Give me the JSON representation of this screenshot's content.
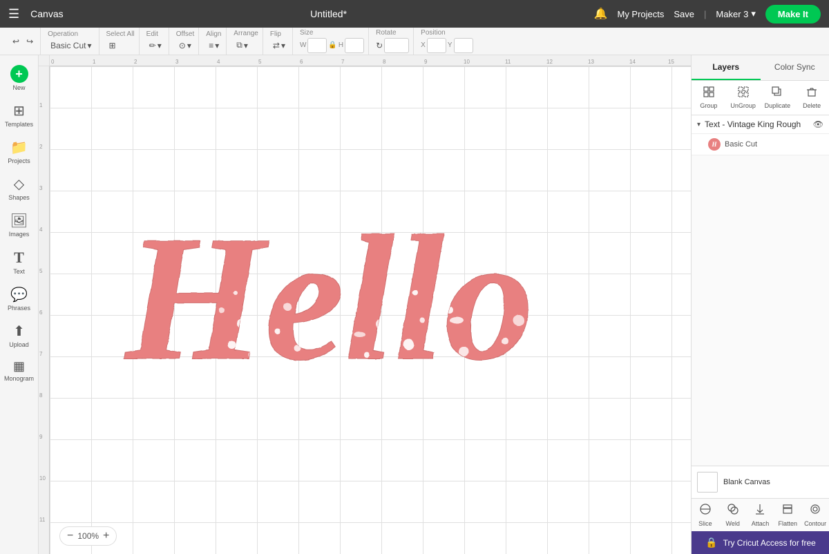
{
  "topbar": {
    "menu_icon": "☰",
    "title": "Canvas",
    "project_name": "Untitled*",
    "bell_icon": "🔔",
    "my_projects": "My Projects",
    "save": "Save",
    "divider": "|",
    "maker": "Maker 3",
    "maker_chevron": "▾",
    "make_it": "Make It"
  },
  "toolbar": {
    "undo_icon": "↩",
    "redo_icon": "↪",
    "operation_label": "Operation",
    "operation_value": "Basic Cut",
    "select_all_label": "Select All",
    "edit_label": "Edit",
    "offset_label": "Offset",
    "align_label": "Align",
    "arrange_label": "Arrange",
    "flip_label": "Flip",
    "size_label": "Size",
    "size_w": "W",
    "size_h": "H",
    "lock_icon": "🔒",
    "rotate_label": "Rotate",
    "position_label": "Position",
    "position_x": "X",
    "position_y": "Y"
  },
  "sidebar": {
    "items": [
      {
        "id": "new",
        "icon": "+",
        "label": "New"
      },
      {
        "id": "templates",
        "icon": "⊞",
        "label": "Templates"
      },
      {
        "id": "projects",
        "icon": "📁",
        "label": "Projects"
      },
      {
        "id": "shapes",
        "icon": "◇",
        "label": "Shapes"
      },
      {
        "id": "images",
        "icon": "🖼",
        "label": "Images"
      },
      {
        "id": "text",
        "icon": "T",
        "label": "Text"
      },
      {
        "id": "phrases",
        "icon": "💬",
        "label": "Phrases"
      },
      {
        "id": "upload",
        "icon": "⬆",
        "label": "Upload"
      },
      {
        "id": "monogram",
        "icon": "▦",
        "label": "Monogram"
      }
    ]
  },
  "right_panel": {
    "tabs": [
      {
        "id": "layers",
        "label": "Layers",
        "active": true
      },
      {
        "id": "color_sync",
        "label": "Color Sync",
        "active": false
      }
    ],
    "actions": [
      {
        "id": "group",
        "label": "Group",
        "icon": "⊞",
        "disabled": false
      },
      {
        "id": "ungroup",
        "label": "UnGroup",
        "icon": "⊟",
        "disabled": false
      },
      {
        "id": "duplicate",
        "label": "Duplicate",
        "icon": "⧉",
        "disabled": false
      },
      {
        "id": "delete",
        "label": "Delete",
        "icon": "🗑",
        "disabled": false
      }
    ],
    "layers": [
      {
        "id": "text-vintage",
        "name": "Text - Vintage King Rough",
        "expanded": true,
        "visible": true,
        "children": [
          {
            "id": "basic-cut",
            "name": "Basic Cut",
            "color": "#e88080"
          }
        ]
      }
    ],
    "blank_canvas": {
      "label": "Blank Canvas"
    },
    "bottom_tools": [
      {
        "id": "slice",
        "label": "Slice",
        "icon": "◎"
      },
      {
        "id": "weld",
        "label": "Weld",
        "icon": "⊕"
      },
      {
        "id": "attach",
        "label": "Attach",
        "icon": "📎"
      },
      {
        "id": "flatten",
        "label": "Flatten",
        "icon": "⧉"
      },
      {
        "id": "contour",
        "label": "Contour",
        "icon": "〇"
      }
    ],
    "try_cricut": {
      "icon": "🔒",
      "label": "Try Cricut Access for free"
    }
  },
  "canvas": {
    "zoom": "100%",
    "zoom_in_icon": "+",
    "zoom_out_icon": "−",
    "ruler_ticks_h": [
      "0",
      "1",
      "2",
      "3",
      "4",
      "5",
      "6",
      "7",
      "8",
      "9",
      "10",
      "11",
      "12",
      "13",
      "14",
      "15"
    ],
    "ruler_ticks_v": [
      "1",
      "2",
      "3",
      "4",
      "5",
      "6",
      "7",
      "8",
      "9",
      "10",
      "11"
    ]
  },
  "hello_text": {
    "fill_color": "#e88080",
    "stroke_color": "#d06060",
    "display": "Hello"
  }
}
